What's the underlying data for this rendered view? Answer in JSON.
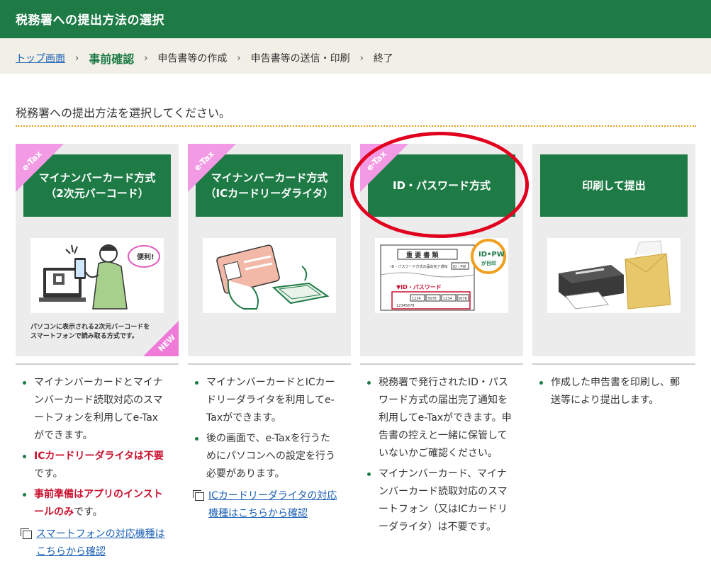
{
  "header": {
    "title": "税務署への提出方法の選択"
  },
  "breadcrumb": {
    "home": "トップ画面",
    "current": "事前確認",
    "step3": "申告書等の作成",
    "step4": "申告書等の送信・印刷",
    "step5": "終了",
    "sep": "›"
  },
  "lead": "税務署への提出方法を選択してください。",
  "cards": [
    {
      "ribbon": "e-Tax",
      "button": "マイナンバーカード方式\n（2次元バーコード）",
      "caption": "パソコンに表示される2次元バーコードをスマートフォンで読み取る方式です。",
      "new": "NEW",
      "bubble": "便利!",
      "desc": {
        "item1": "マイナンバーカードとマイナンバーカード読取対応のスマートフォンを利用してe-Taxができます。",
        "item2_red": "ICカードリーダライタは不要",
        "item2_tail": "です。",
        "item3_red": "事前準備はアプリのインストールのみ",
        "item3_tail": "です。",
        "link": "スマートフォンの対応機種はこちらから確認"
      }
    },
    {
      "ribbon": "e-Tax",
      "button": "マイナンバーカード方式\n（ICカードリーダライタ）",
      "desc": {
        "item1": "マイナンバーカードとICカードリーダライタを利用してe-Taxができます。",
        "item2": "後の画面で、e-Taxを行うためにパソコンへの設定を行う必要があります。",
        "link": "ICカードリーダライタの対応機種はこちらから確認"
      }
    },
    {
      "ribbon": "e-Tax",
      "button": "ID・パスワード方式",
      "doc": {
        "title": "重 要 書 類",
        "subtitle": "ID・パスワード方式の届出完了通知",
        "tag": "ID・PW",
        "badge1": "ID•PW",
        "badge2": "が目印",
        "label": "▼ID・パスワード",
        "cells": [
          "1234",
          "5678",
          "1234",
          "5678"
        ],
        "number": "12345678"
      },
      "desc": {
        "item1": "税務署で発行されたID・パスワード方式の届出完了通知を利用してe-Taxができます。申告書の控えと一緒に保管していないかご確認ください。",
        "item2": "マイナンバーカード、マイナンバーカード読取対応のスマートフォン（又はICカードリーダライタ）は不要です。"
      }
    },
    {
      "button": "印刷して提出",
      "desc": {
        "item1": "作成した申告書を印刷し、郵送等により提出します。"
      }
    }
  ],
  "colors": {
    "brand_green": "#1e7b46",
    "ribbon_pink": "#f29ae3",
    "alert_red": "#c8102e",
    "highlight_oval": "#e1001e",
    "beige": "#f1efe6"
  }
}
